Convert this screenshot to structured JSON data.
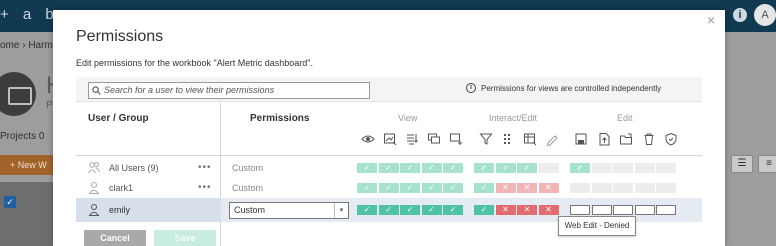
{
  "background_app": {
    "logo_text": "+ a b",
    "breadcrumb": "ome  ›  Harma",
    "project_title": "H",
    "project_sub": "P",
    "projects_label": "Projects  0",
    "new_button": "+ New W",
    "info_icon": "i",
    "avatar_letter": "A"
  },
  "dialog": {
    "close_label": "×",
    "title": "Permissions",
    "subtitle": "Edit permissions for the workbook \"Alert Metric dashboard\".",
    "search_placeholder": "Search for a user to view their permissions",
    "note_text": "Permissions for views are controlled independently",
    "header_user_group": "User / Group",
    "header_permissions": "Permissions",
    "capability_groups": [
      {
        "label": "View",
        "icons": [
          "eye-icon",
          "image-icon",
          "filter-list-icon",
          "comment-icon",
          "add-comment-icon"
        ]
      },
      {
        "label": "Interact/Edit",
        "icons": [
          "funnel-icon",
          "grid-dots-icon",
          "table-icon",
          "pencil-icon"
        ]
      },
      {
        "label": "Edit",
        "icons": [
          "save-icon",
          "upload-icon",
          "folder-move-icon",
          "trash-icon",
          "shield-icon"
        ]
      }
    ],
    "rows": [
      {
        "name": "All Users (9)",
        "type": "group",
        "permission": "Custom",
        "more": "•••",
        "view": [
          "allow",
          "allow",
          "allow",
          "allow",
          "allow"
        ],
        "interact": [
          "allow",
          "allow",
          "allow",
          "none"
        ],
        "edit": [
          "allow",
          "none",
          "none",
          "none",
          "none"
        ]
      },
      {
        "name": "clark1",
        "type": "user",
        "permission": "Custom",
        "more": "•••",
        "view": [
          "allow",
          "allow",
          "allow",
          "allow",
          "allow"
        ],
        "interact": [
          "allow",
          "deny",
          "deny",
          "deny"
        ],
        "edit": [
          "none",
          "none",
          "none",
          "none",
          "none"
        ]
      },
      {
        "name": "emily",
        "type": "user",
        "permission": "Custom",
        "more": "",
        "view": [
          "allow",
          "allow",
          "allow",
          "allow",
          "allow"
        ],
        "interact": [
          "allow",
          "deny",
          "deny",
          "deny"
        ],
        "edit": [
          "outline",
          "outline",
          "outline",
          "outline",
          "outline"
        ]
      }
    ],
    "check_glyph": "✓",
    "cross_glyph": "✕",
    "select_arrow": "▾",
    "cancel_label": "Cancel",
    "save_label": "Save",
    "tooltip": "Web Edit - Denied"
  },
  "colors": {
    "allow": "#4fc3a1",
    "deny": "#e36a6f",
    "none": "#e4e4e4",
    "topbar": "#0f3a52",
    "cancel": "#a9a9a9",
    "save_disabled": "#c9ece0"
  }
}
